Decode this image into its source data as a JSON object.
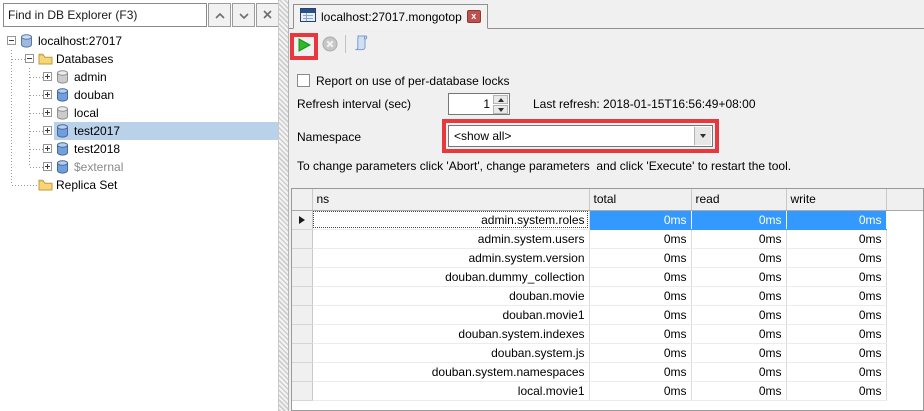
{
  "left_panel": {
    "search": {
      "value": "Find in DB Explorer (F3)",
      "buttons": {
        "previous": "chevron-up-icon",
        "next": "chevron-down-icon",
        "close": "close-icon"
      }
    },
    "tree": {
      "items": [
        {
          "label": "localhost:27017",
          "level": 0,
          "expander": "minus",
          "icon": "server-database-icon"
        },
        {
          "label": "Databases",
          "level": 1,
          "expander": "minus",
          "icon": "folder-icon"
        },
        {
          "label": "admin",
          "level": 2,
          "expander": "plus",
          "icon": "database-gray-icon"
        },
        {
          "label": "douban",
          "level": 2,
          "expander": "plus",
          "icon": "database-blue-icon"
        },
        {
          "label": "local",
          "level": 2,
          "expander": "plus",
          "icon": "database-gray-icon"
        },
        {
          "label": "test2017",
          "level": 2,
          "expander": "plus",
          "icon": "database-blue-icon",
          "selected": true
        },
        {
          "label": "test2018",
          "level": 2,
          "expander": "plus",
          "icon": "database-blue-icon"
        },
        {
          "label": "$external",
          "level": 2,
          "expander": "plus",
          "icon": "database-blue-icon",
          "muted": true
        },
        {
          "label": "Replica Set",
          "level": 1,
          "expander": "none",
          "icon": "folder-icon"
        }
      ]
    }
  },
  "main": {
    "tab": {
      "title": "localhost:27017.mongotop",
      "close_label": "x"
    },
    "toolbar": {
      "buttons": [
        {
          "name": "execute-button",
          "icon": "play-icon",
          "annotated": true
        },
        {
          "name": "abort-button",
          "icon": "stop-icon",
          "disabled": true
        },
        {
          "name": "script-button",
          "icon": "script-icon"
        }
      ]
    },
    "options": {
      "locks_checkbox_label": "Report on use of per-database locks",
      "locks_checked": false,
      "refresh_interval_label": "Refresh interval (sec)",
      "refresh_interval_value": "1",
      "last_refresh": "Last refresh: 2018-01-15T16:56:49+08:00",
      "namespace_label": "Namespace",
      "namespace_value": "<show all>",
      "instruction": "To change parameters click 'Abort', change parameters  and click 'Execute' to restart the tool."
    },
    "table": {
      "columns": [
        "ns",
        "total",
        "read",
        "write"
      ],
      "rows": [
        {
          "ns": "admin.system.roles",
          "total": "0ms",
          "read": "0ms",
          "write": "0ms",
          "selected": true
        },
        {
          "ns": "admin.system.users",
          "total": "0ms",
          "read": "0ms",
          "write": "0ms"
        },
        {
          "ns": "admin.system.version",
          "total": "0ms",
          "read": "0ms",
          "write": "0ms"
        },
        {
          "ns": "douban.dummy_collection",
          "total": "0ms",
          "read": "0ms",
          "write": "0ms"
        },
        {
          "ns": "douban.movie",
          "total": "0ms",
          "read": "0ms",
          "write": "0ms"
        },
        {
          "ns": "douban.movie1",
          "total": "0ms",
          "read": "0ms",
          "write": "0ms"
        },
        {
          "ns": "douban.system.indexes",
          "total": "0ms",
          "read": "0ms",
          "write": "0ms"
        },
        {
          "ns": "douban.system.js",
          "total": "0ms",
          "read": "0ms",
          "write": "0ms"
        },
        {
          "ns": "douban.system.namespaces",
          "total": "0ms",
          "read": "0ms",
          "write": "0ms"
        },
        {
          "ns": "local.movie1",
          "total": "0ms",
          "read": "0ms",
          "write": "0ms"
        }
      ]
    }
  },
  "colors": {
    "selection_blue": "#3399ff",
    "annotation_red": "#e8383d",
    "tree_selection": "#b9d1e9",
    "play_green": "#2eb82e"
  }
}
